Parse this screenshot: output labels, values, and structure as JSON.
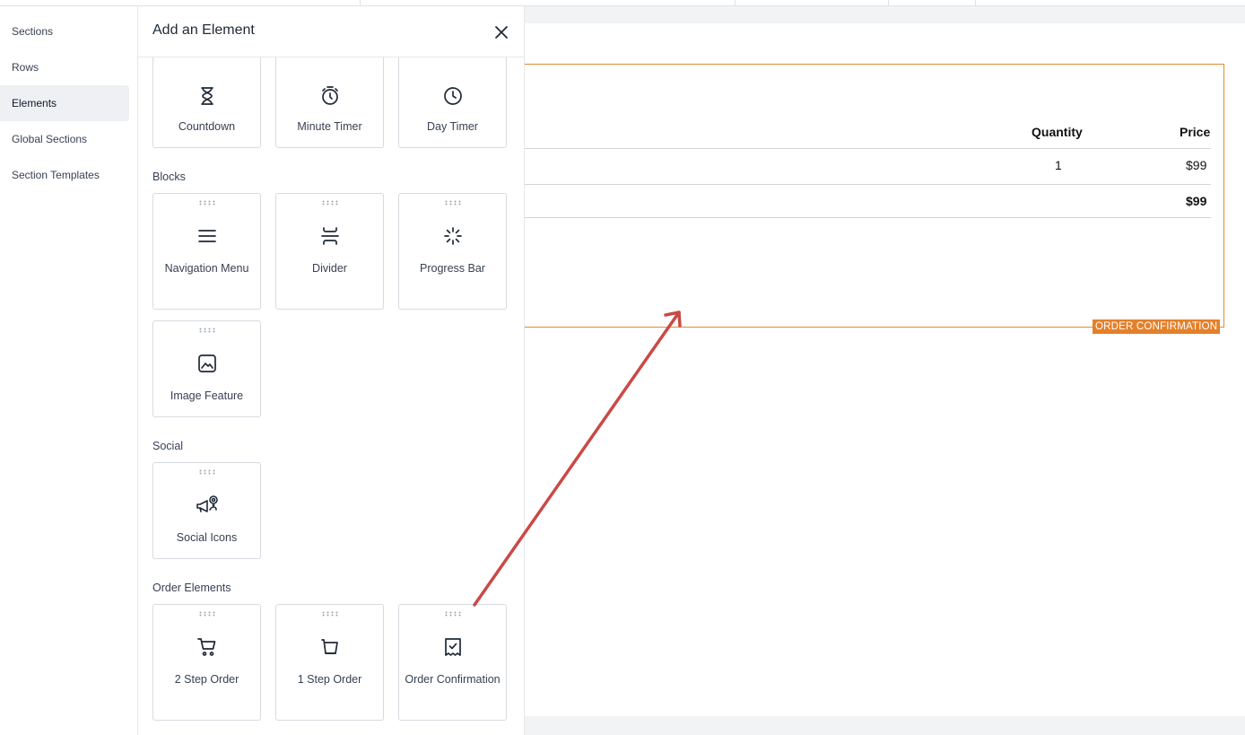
{
  "left_nav": {
    "items": [
      {
        "label": "Sections"
      },
      {
        "label": "Rows"
      },
      {
        "label": "Elements"
      },
      {
        "label": "Global Sections"
      },
      {
        "label": "Section Templates"
      }
    ],
    "active": "Elements"
  },
  "panel": {
    "title": "Add an Element",
    "close_icon": "close-icon",
    "timers": [
      {
        "label": "Countdown",
        "icon": "hourglass-icon"
      },
      {
        "label": "Minute Timer",
        "icon": "stopwatch-icon"
      },
      {
        "label": "Day Timer",
        "icon": "clock-icon"
      }
    ],
    "groups": {
      "blocks": "Blocks",
      "social": "Social",
      "order": "Order Elements"
    },
    "blocks": [
      {
        "label": "Navigation Menu",
        "icon": "menu-icon"
      },
      {
        "label": "Divider",
        "icon": "divider-icon"
      },
      {
        "label": "Progress Bar",
        "icon": "loader-icon"
      },
      {
        "label": "Image Feature",
        "icon": "image-icon"
      }
    ],
    "social": [
      {
        "label": "Social Icons",
        "icon": "social-megaphone-icon"
      }
    ],
    "order": [
      {
        "label": "2 Step Order",
        "icon": "cart-icon"
      },
      {
        "label": "1 Step Order",
        "icon": "basket-icon"
      },
      {
        "label": "Order Confirmation",
        "icon": "receipt-check-icon"
      }
    ]
  },
  "canvas": {
    "table": {
      "headers": {
        "quantity": "Quantity",
        "price": "Price"
      },
      "row": {
        "quantity": "1",
        "price": "$99"
      },
      "total": "$99"
    },
    "badge": "ORDER CONFIRMATION",
    "colors": {
      "selection": "#e48a2f",
      "badge": "#e4802a",
      "arrow": "#c94a46"
    }
  }
}
